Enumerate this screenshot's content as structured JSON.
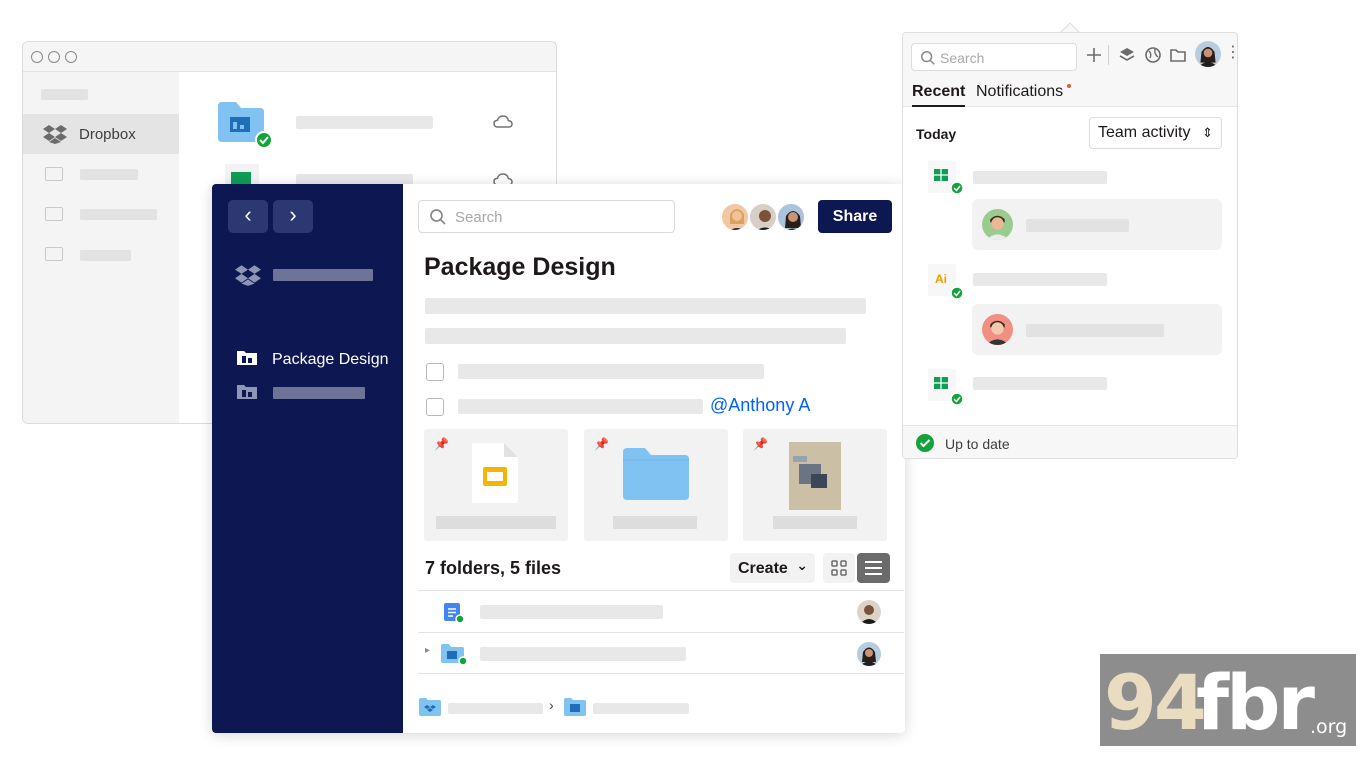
{
  "finder": {
    "sidebar_item_label": "Dropbox"
  },
  "app": {
    "back_glyph": "‹",
    "forward_glyph": "›",
    "sidebar_item_label": "Package Design",
    "search_placeholder": "Search",
    "share_label": "Share",
    "title": "Package Design",
    "mention": "@Anthony A",
    "count_label": "7 folders, 5 files",
    "create_label": "Create",
    "create_chevron": "⌄"
  },
  "panel": {
    "search_placeholder": "Search",
    "tabs": {
      "recent": "Recent",
      "notifications": "Notifications"
    },
    "today_label": "Today",
    "filter_value": "Team activity",
    "filter_chevron": "⌃⌄",
    "status_text": "Up to date",
    "file_badge_ai": "Ai"
  },
  "watermark": {
    "num": "94",
    "text": "fbr",
    "tld": ".org"
  },
  "colors": {
    "navy": "#0d1852",
    "accent_blue": "#0061fe",
    "success_green": "#14a33a",
    "folder_blue": "#80c3f3"
  },
  "icons": [
    "search-icon",
    "dropbox-icon",
    "folder-icon",
    "cloud-icon",
    "sheets-icon",
    "slides-icon",
    "pin-icon",
    "grid-view-icon",
    "list-view-icon",
    "plus-icon",
    "layers-icon",
    "globe-icon",
    "check-circle-icon"
  ]
}
